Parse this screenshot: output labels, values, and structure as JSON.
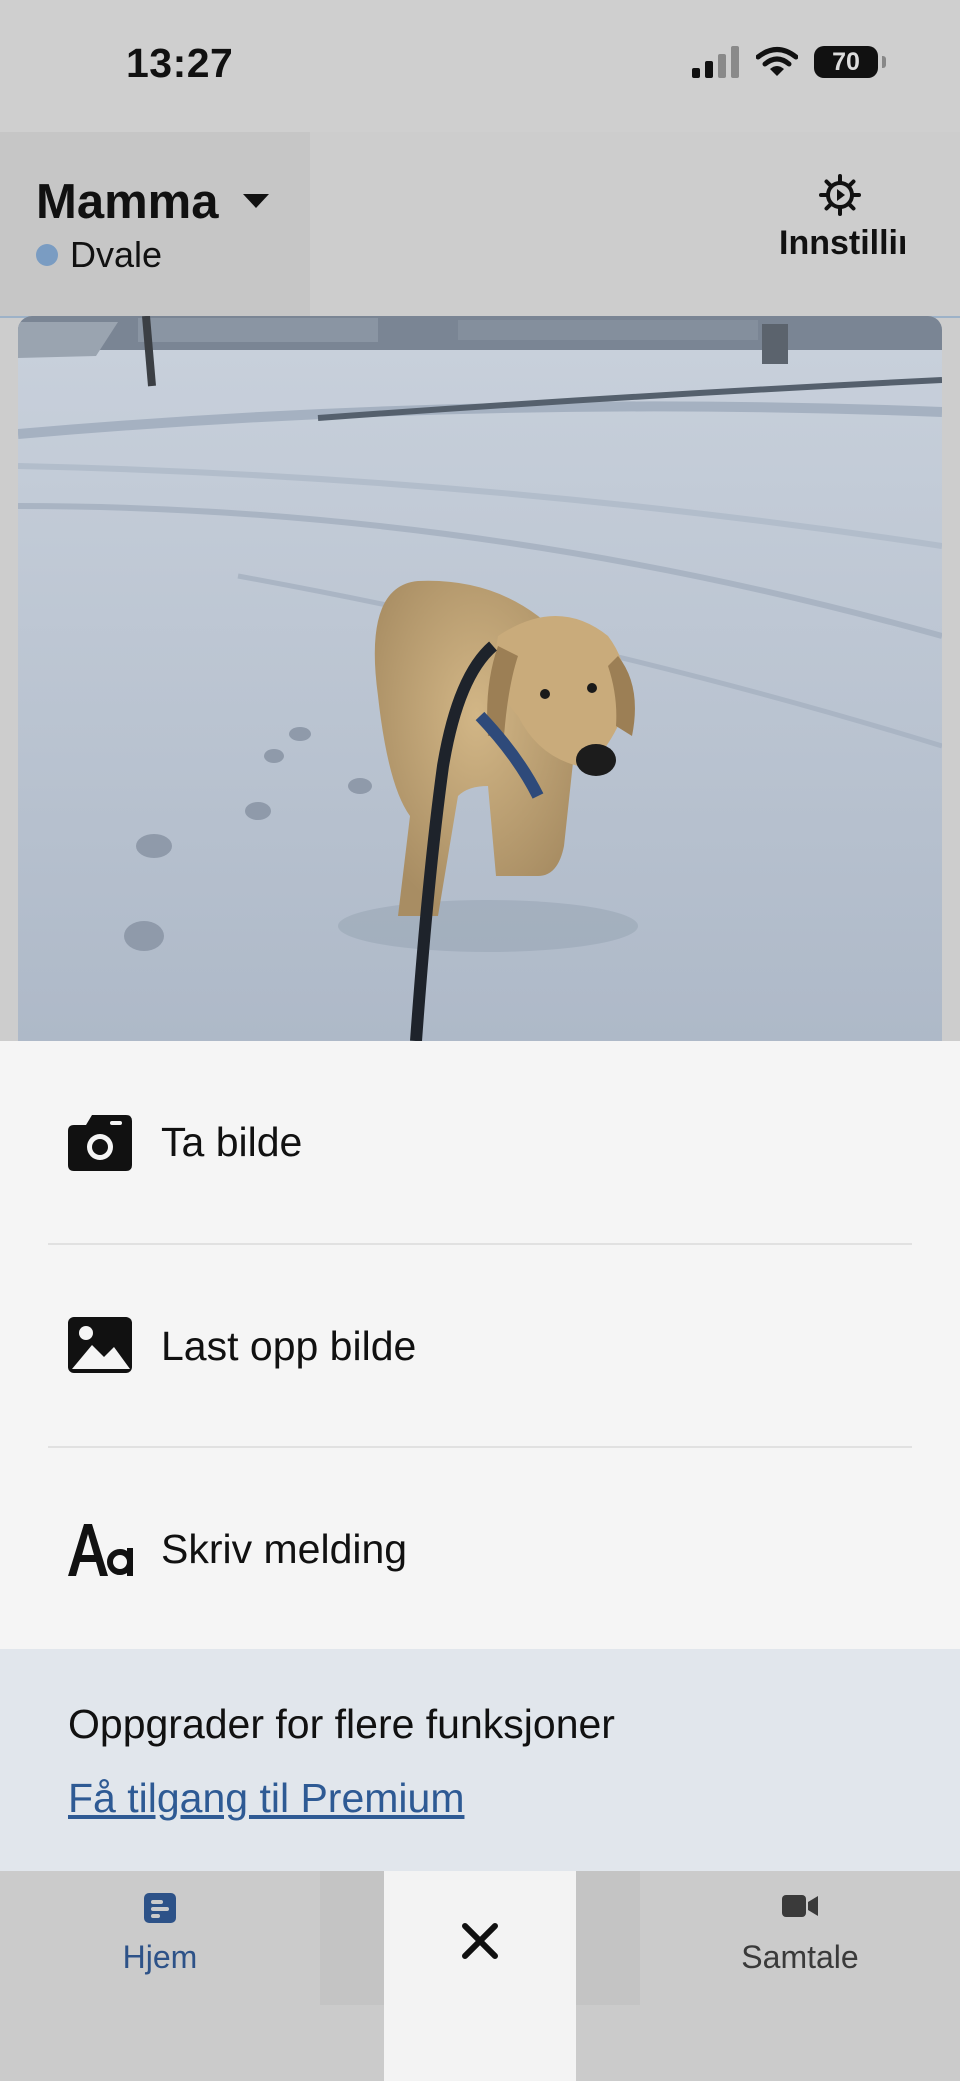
{
  "status_bar": {
    "time": "13:27",
    "battery": "70"
  },
  "header": {
    "profile_name": "Mamma",
    "status_label": "Dvale",
    "settings_label": "Innstillinger"
  },
  "menu": {
    "items": [
      {
        "label": "Ta bilde",
        "icon": "camera-icon"
      },
      {
        "label": "Last opp bilde",
        "icon": "image-icon"
      },
      {
        "label": "Skriv melding",
        "icon": "text-icon"
      }
    ]
  },
  "upgrade": {
    "title": "Oppgrader for flere funksjoner",
    "link": "Få tilgang til Premium"
  },
  "tabbar": {
    "home_label": "Hjem",
    "call_label": "Samtale"
  },
  "colors": {
    "accent": "#2e5a94",
    "status_dot": "#7a9cc2",
    "sheet_bg": "#f5f5f5",
    "upgrade_bg": "#e1e6ec"
  }
}
